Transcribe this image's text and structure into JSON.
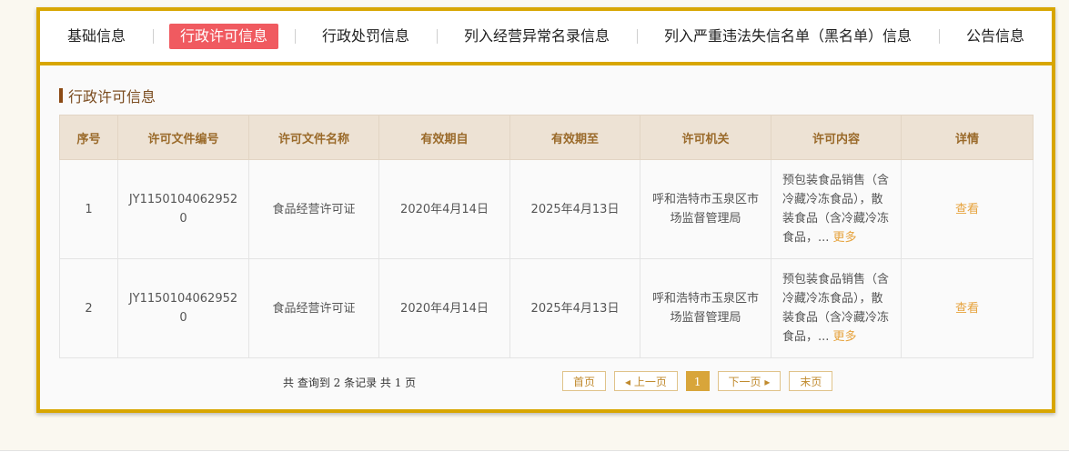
{
  "tabs": [
    {
      "label": "基础信息",
      "active": false
    },
    {
      "label": "行政许可信息",
      "active": true
    },
    {
      "label": "行政处罚信息",
      "active": false
    },
    {
      "label": "列入经营异常名录信息",
      "active": false
    },
    {
      "label": "列入严重违法失信名单（黑名单）信息",
      "active": false
    },
    {
      "label": "公告信息",
      "active": false
    }
  ],
  "section": {
    "title": "行政许可信息"
  },
  "table": {
    "headers": [
      "序号",
      "许可文件编号",
      "许可文件名称",
      "有效期自",
      "有效期至",
      "许可机关",
      "许可内容",
      "详情"
    ],
    "rows": [
      {
        "index": "1",
        "license_no": "JY11501040629520",
        "license_name": "食品经营许可证",
        "valid_from": "2020年4月14日",
        "valid_to": "2025年4月13日",
        "authority": "呼和浩特市玉泉区市场监督管理局",
        "content": "预包装食品销售（含冷藏冷冻食品），散装食品（含冷藏冷冻食品，...",
        "more": "更多",
        "detail": "查看"
      },
      {
        "index": "2",
        "license_no": "JY11501040629520",
        "license_name": "食品经营许可证",
        "valid_from": "2020年4月14日",
        "valid_to": "2025年4月13日",
        "authority": "呼和浩特市玉泉区市场监督管理局",
        "content": "预包装食品销售（含冷藏冷冻食品），散装食品（含冷藏冷冻食品，...",
        "more": "更多",
        "detail": "查看"
      }
    ]
  },
  "pager": {
    "summary": "共 查询到 2 条记录 共 1 页",
    "first": "首页",
    "prev": "◂ 上一页",
    "current": "1",
    "next": "下一页 ▸",
    "last": "末页"
  },
  "colors": {
    "border": "#d8a600",
    "active_tab": "#f05a60",
    "header_bg": "#ede2d4",
    "link": "#e6a23c"
  }
}
